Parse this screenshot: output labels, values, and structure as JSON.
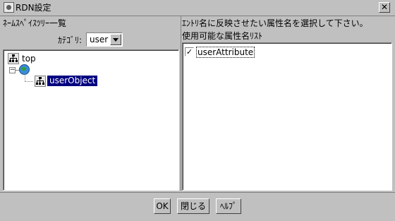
{
  "window": {
    "title": "RDN設定",
    "close_glyph": "✕"
  },
  "left": {
    "header": "ﾈｰﾑｽﾍﾟｲｽﾂﾘｰ一覧",
    "category_label": "ｶﾃｺﾞﾘ:",
    "category_value": "user",
    "tree": {
      "root_label": "top",
      "toggle_glyph": "−",
      "child_label": "userObject"
    }
  },
  "right": {
    "instruction": "ｴﾝﾄﾘ名に反映させたい属性名を選択して下さい。",
    "list_header": "使用可能な属性名ﾘｽﾄ",
    "attributes": [
      {
        "name": "userAttribute",
        "checked": true,
        "check_glyph": "✓"
      }
    ]
  },
  "buttons": {
    "ok": "OK",
    "close": "閉じる",
    "help": "ﾍﾙﾌﾟ"
  },
  "icons": {
    "app": "app-icon",
    "tree_root": "hierarchy-icon",
    "namespace": "globe-icon",
    "tree_child": "hierarchy-icon"
  }
}
